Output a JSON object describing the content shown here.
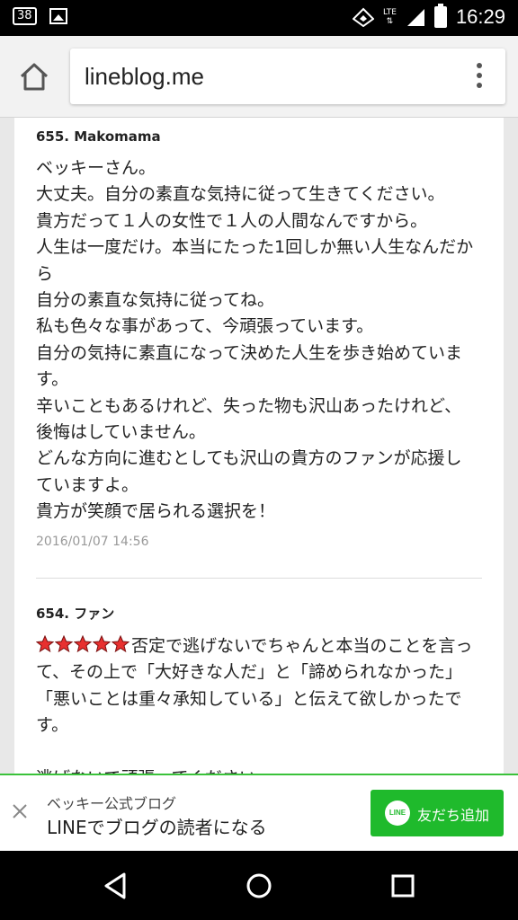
{
  "status_bar": {
    "notification_count": "38",
    "network": "LTE",
    "time": "16:29"
  },
  "browser": {
    "url": "lineblog.me"
  },
  "posts": [
    {
      "header": "655.  Makomama",
      "lines": [
        "ベッキーさん。",
        "大丈夫。自分の素直な気持に従って生きてください。",
        "貴方だって１人の女性で１人の人間なんですから。",
        "人生は一度だけ。本当にたった1回しか無い人生なんだか",
        "ら",
        "自分の素直な気持に従ってね。",
        "私も色々な事があって、今頑張っています。",
        "自分の気持に素直になって決めた人生を歩き始めていま",
        "す。",
        "辛いこともあるけれど、失った物も沢山あったけれど、",
        "後悔はしていません。",
        "どんな方向に進むとしても沢山の貴方のファンが応援し",
        "ていますよ。",
        "貴方が笑顔で居られる選択を！"
      ],
      "date": "2016/01/07 14:56"
    },
    {
      "header": "654.  ファン",
      "first_line_text": "否定で逃げないでちゃんと本当のことを言っ",
      "lines": [
        "て、その上で「大好きな人だ」と「諦められなかった」",
        "「悪いことは重々承知している」と伝えて欲しかったで",
        "す。",
        "",
        "逃げないで頑張ってください"
      ]
    }
  ],
  "banner": {
    "subtitle": "ベッキー公式ブログ",
    "title": "LINEでブログの読者になる",
    "button_label": "友だち追加",
    "logo_text": "LINE"
  },
  "colors": {
    "accent": "#1fba2c",
    "star": "#e8302f"
  }
}
